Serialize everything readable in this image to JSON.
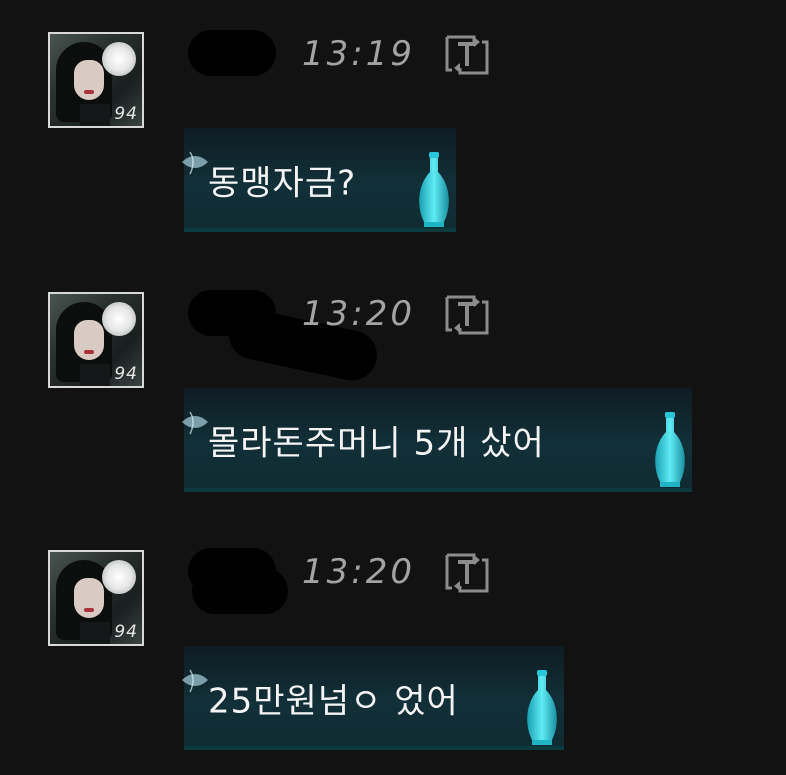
{
  "messages": [
    {
      "avatar": {
        "level": "94"
      },
      "timestamp": "13:19",
      "text": "동맹자금?",
      "icons": {
        "translate": "translate-icon",
        "decoration": "vase-icon"
      }
    },
    {
      "avatar": {
        "level": "94"
      },
      "timestamp": "13:20",
      "text": "몰라돈주머니 5개 샀어",
      "icons": {
        "translate": "translate-icon",
        "decoration": "vase-icon"
      }
    },
    {
      "avatar": {
        "level": "94"
      },
      "timestamp": "13:20",
      "text": "25만원넘ㅇ 었어",
      "icons": {
        "translate": "translate-icon",
        "decoration": "vase-icon"
      }
    }
  ],
  "colors": {
    "background": "#121212",
    "timestamp": "#a3a3a3",
    "bubble": "#123039",
    "vase": "#36d6e6",
    "text": "#f4f4f4"
  }
}
